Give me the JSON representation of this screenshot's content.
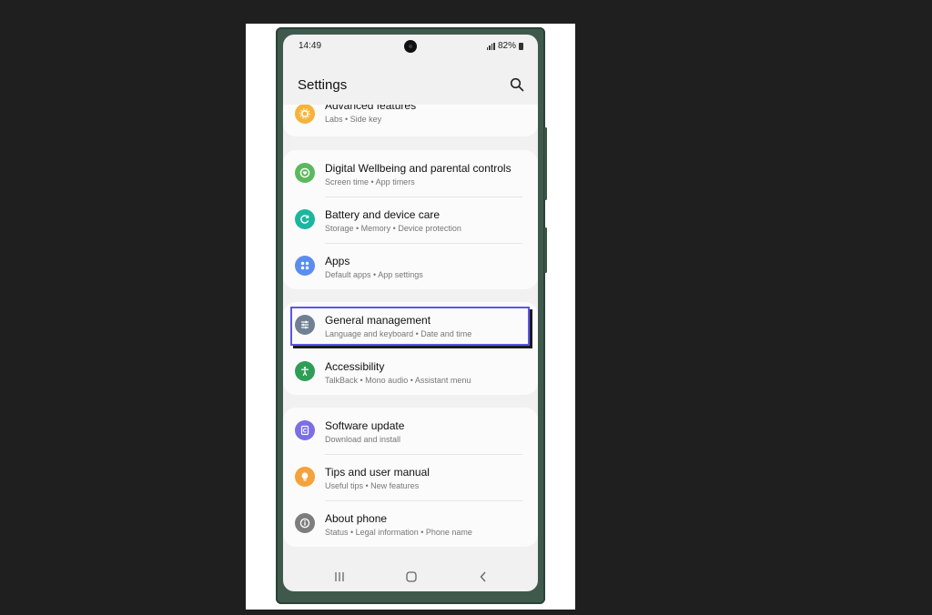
{
  "status_bar": {
    "time": "14:49",
    "battery": "82%"
  },
  "header": {
    "title": "Settings",
    "search_icon": "search-icon"
  },
  "groups": [
    {
      "items": [
        {
          "title": "Advanced features",
          "subtitle": "Labs  •  Side key",
          "icon": "gear-plus-icon",
          "color": "#f6b33a"
        }
      ]
    },
    {
      "items": [
        {
          "title": "Digital Wellbeing and parental controls",
          "subtitle": "Screen time  •  App timers",
          "icon": "heart-circle-icon",
          "color": "#5cb85c"
        },
        {
          "title": "Battery and device care",
          "subtitle": "Storage  •  Memory  •  Device protection",
          "icon": "refresh-circle-icon",
          "color": "#1bb6a0"
        },
        {
          "title": "Apps",
          "subtitle": "Default apps  •  App settings",
          "icon": "apps-grid-icon",
          "color": "#5b8df0"
        }
      ]
    },
    {
      "items": [
        {
          "title": "General management",
          "subtitle": "Language and keyboard  •  Date and time",
          "icon": "sliders-icon",
          "color": "#6f7f94"
        },
        {
          "title": "Accessibility",
          "subtitle": "TalkBack  •  Mono audio  •  Assistant menu",
          "icon": "accessibility-icon",
          "color": "#2e9e57"
        }
      ]
    },
    {
      "items": [
        {
          "title": "Software update",
          "subtitle": "Download and install",
          "icon": "update-icon",
          "color": "#7a6fe6"
        },
        {
          "title": "Tips and user manual",
          "subtitle": "Useful tips  •  New features",
          "icon": "lightbulb-icon",
          "color": "#f4a23c"
        },
        {
          "title": "About phone",
          "subtitle": "Status  •  Legal information  •  Phone name",
          "icon": "info-icon",
          "color": "#7d7d7d"
        }
      ]
    }
  ],
  "nav_bar": {
    "recents": "recents-icon",
    "home": "home-icon",
    "back": "back-icon"
  },
  "highlight": {
    "target": "General management",
    "color": "#5a57e8"
  }
}
